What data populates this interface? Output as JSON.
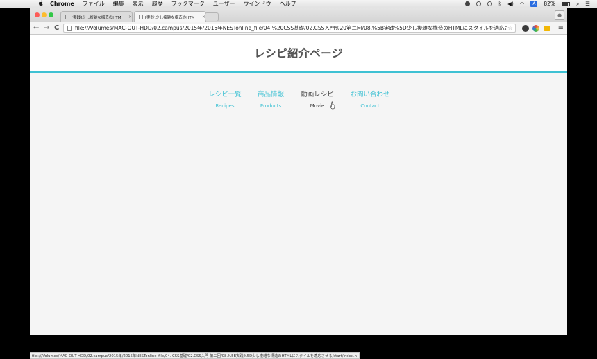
{
  "menubar": {
    "apple": "",
    "app": "Chrome",
    "items": [
      "ファイル",
      "編集",
      "表示",
      "履歴",
      "ブックマーク",
      "ユーザー",
      "ウインドウ",
      "ヘルプ"
    ],
    "battery_text": "82%",
    "input_badge": "A"
  },
  "tabs": [
    {
      "title": "[実践]少し複雑な構造のHTM",
      "close": "×"
    },
    {
      "title": "[実践]少し複雑な構造のHTM",
      "close": "×"
    }
  ],
  "toolbar": {
    "back": "←",
    "forward": "→",
    "reload": "C",
    "url": "file:///Volumes/MAC-OUT-HDD/02.campus/2015年/2015年NESTonline_file/04.%20CSS基礎/02.CSS入門%20第二回/08.%5B実践%5D少し複雑な構造のHTMLにスタイルを適応させ…",
    "star": "☆",
    "menu": "≡"
  },
  "page": {
    "title": "レシピ紹介ページ",
    "nav": [
      {
        "jp": "レシピ一覧",
        "en": "Recipes"
      },
      {
        "jp": "商品情報",
        "en": "Products"
      },
      {
        "jp": "動画レシピ",
        "en": "Movie"
      },
      {
        "jp": "お問い合わせ",
        "en": "Contact"
      }
    ]
  },
  "statusbar": {
    "text": "file:///Volumes/MAC-OUT-HDD/02.campus/2015年/2015年NESTonline_file/04. CSS基礎/02.CSS入門 第二回/08.%5B実践%5D少し複雑な構造のHTMLにスタイルを適応させる/start/index.h"
  },
  "colors": {
    "accent": "#3ec1d3",
    "title": "#555555",
    "hover": "#444444"
  }
}
